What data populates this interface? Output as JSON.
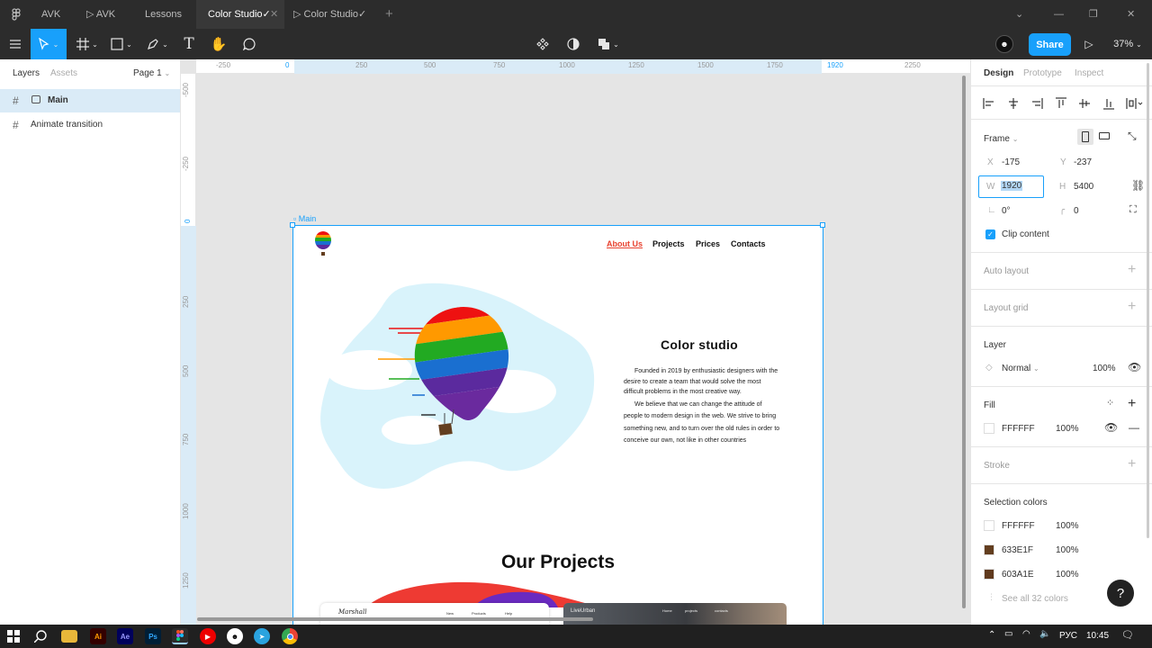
{
  "tabs": [
    {
      "label": "AVK"
    },
    {
      "label": "AVK"
    },
    {
      "label": "Lessons"
    },
    {
      "label": "Color Studio✓"
    },
    {
      "label": "Color Studio✓"
    }
  ],
  "toolbar": {
    "share_label": "Share",
    "zoom": "37%"
  },
  "left_panel": {
    "tabs": {
      "layers": "Layers",
      "assets": "Assets"
    },
    "page": "Page 1",
    "layers": [
      {
        "label": "Main"
      },
      {
        "label": "Animate transition"
      }
    ]
  },
  "ruler": {
    "top": [
      "-250",
      "0",
      "250",
      "500",
      "750",
      "1000",
      "1250",
      "1500",
      "1750",
      "1920",
      "2250"
    ],
    "left": [
      "-500",
      "-250",
      "0",
      "250",
      "500",
      "750",
      "1000",
      "1250"
    ]
  },
  "canvas": {
    "frame_label": "Main",
    "site": {
      "nav": [
        "About Us",
        "Projects",
        "Prices",
        "Contacts"
      ],
      "hero_title": "Color studio",
      "hero_p1": "Founded in 2019 by enthusiastic designers with the desire to create a team that would solve the most difficult problems in the most creative way.",
      "hero_p2": "We believe that we can change the attitude of people to modern design in the web. We strive to bring something new, and to turn over the old rules in order to conceive our own, not like in other countries",
      "projects_title": "Our Projects",
      "card1_brand": "Marshall",
      "card1_nav": [
        "New",
        "Products",
        "Help"
      ],
      "card2_brand": "LiveUrban",
      "card3_nav": [
        "Home",
        "projects",
        "contacts"
      ]
    }
  },
  "right_panel": {
    "tabs": {
      "design": "Design",
      "prototype": "Prototype",
      "inspect": "Inspect"
    },
    "frame": {
      "label": "Frame",
      "x_label": "X",
      "x": "-175",
      "y_label": "Y",
      "y": "-237",
      "w_label": "W",
      "w": "1920",
      "h_label": "H",
      "h": "5400",
      "rotation": "0°",
      "radius": "0",
      "clip_content": "Clip content"
    },
    "auto_layout": "Auto layout",
    "layout_grid": "Layout grid",
    "layer": {
      "label": "Layer",
      "mode": "Normal",
      "opacity": "100%"
    },
    "fill": {
      "label": "Fill",
      "hex": "FFFFFF",
      "opacity": "100%"
    },
    "stroke": "Stroke",
    "selection_colors": {
      "label": "Selection colors",
      "items": [
        {
          "hex": "FFFFFF",
          "opacity": "100%",
          "color": "#FFFFFF"
        },
        {
          "hex": "633E1F",
          "opacity": "100%",
          "color": "#633E1F"
        },
        {
          "hex": "603A1E",
          "opacity": "100%",
          "color": "#603A1E"
        }
      ],
      "see_all": "See all 32 colors"
    },
    "help": "?"
  },
  "taskbar": {
    "lang": "РУС",
    "time": "10:45"
  },
  "colors": {
    "accent": "#18a0fb",
    "dark": "#2c2c2c"
  }
}
